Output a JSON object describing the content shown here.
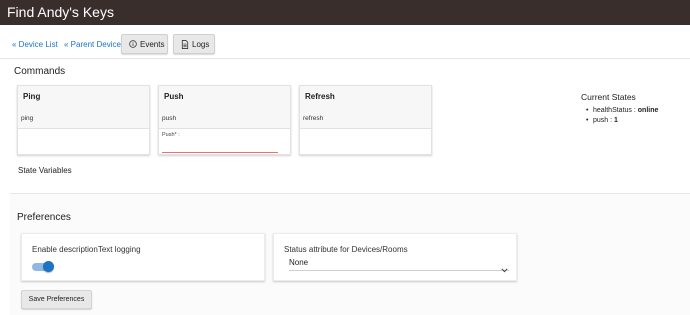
{
  "header": {
    "title": "Find Andy's Keys"
  },
  "nav": {
    "device_list": "« Device List",
    "parent_device": "« Parent Device",
    "events": "Events",
    "logs": "Logs"
  },
  "commands": {
    "heading": "Commands",
    "items": [
      {
        "name": "Ping",
        "sub": "ping"
      },
      {
        "name": "Push",
        "sub": "push",
        "param_label": "Push* :"
      },
      {
        "name": "Refresh",
        "sub": "refresh"
      }
    ]
  },
  "current_states": {
    "title": "Current States",
    "items": [
      {
        "key": "healthStatus",
        "sep": " : ",
        "value": "online"
      },
      {
        "key": "push",
        "sep": " : ",
        "value": "1"
      }
    ]
  },
  "state_variables": {
    "heading": "State Variables"
  },
  "preferences": {
    "heading": "Preferences",
    "description_logging": {
      "label": "Enable descriptionText logging",
      "enabled": true
    },
    "status_attribute": {
      "label": "Status attribute for Devices/Rooms",
      "selected": "None"
    },
    "save_label": "Save Preferences"
  },
  "colors": {
    "topbar": "#3a2e2c",
    "link": "#1a73c9",
    "toggle_on": "#1e73c4"
  },
  "icons": {
    "events": "info-circle-icon",
    "logs": "document-icon",
    "select": "chevron-down-icon"
  }
}
